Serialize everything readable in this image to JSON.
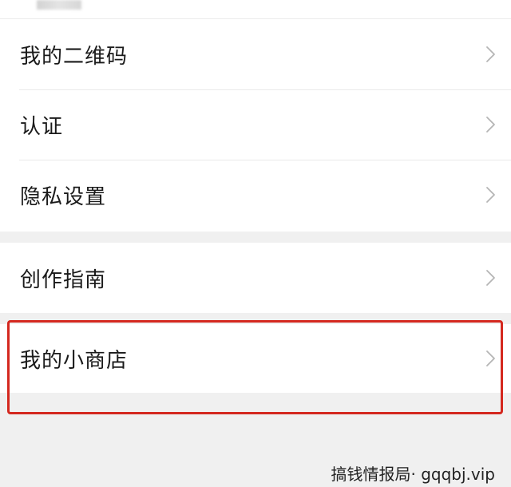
{
  "menu": {
    "group1": [
      {
        "label": "我的二维码",
        "icon": "chevron-right-icon"
      },
      {
        "label": "认证",
        "icon": "chevron-right-icon"
      },
      {
        "label": "隐私设置",
        "icon": "chevron-right-icon"
      }
    ],
    "group2": [
      {
        "label": "创作指南",
        "icon": "chevron-right-icon"
      }
    ],
    "group3": [
      {
        "label": "我的小商店",
        "icon": "chevron-right-icon"
      }
    ]
  },
  "highlight": {
    "color": "#d4281f",
    "target": "我的小商店"
  },
  "watermark": {
    "text": "搞钱情报局· gqqbj.vip"
  },
  "colors": {
    "background": "#f0f0f0",
    "row": "#ffffff",
    "chevron": "#b5b5b5",
    "text": "#1a1a1a"
  }
}
